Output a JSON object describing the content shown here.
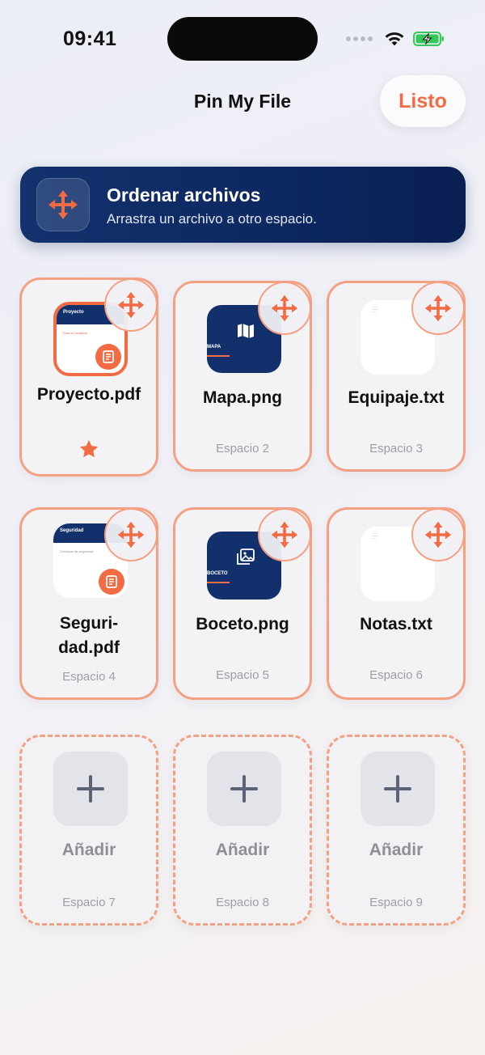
{
  "status_bar": {
    "time": "09:41"
  },
  "header": {
    "title": "Pin My File",
    "done_label": "Listo"
  },
  "banner": {
    "title": "Ordenar archivos",
    "subtitle": "Arrastra un archivo a otro espacio."
  },
  "colors": {
    "accent": "#f26b43",
    "navy": "#12306b",
    "slot_border": "#f4a083"
  },
  "slots": [
    {
      "file": "Proyecto.pdf",
      "label": "",
      "type": "pdf",
      "thumb_title": "Proyecto",
      "thumb_line": "Plan de proyecto",
      "favorite": true,
      "icon": "move-icon"
    },
    {
      "file": "Mapa.png",
      "label": "Espacio 2",
      "type": "image",
      "thumb_title": "MAPA",
      "icon": "move-icon"
    },
    {
      "file": "Equipaje.txt",
      "label": "Espacio 3",
      "type": "text",
      "icon": "move-icon"
    },
    {
      "file_line1": "Seguri-",
      "file_line2": "dad.pdf",
      "label": "Espacio 4",
      "type": "pdf",
      "thumb_title": "Seguridad",
      "thumb_line": "Consejos de seguridad",
      "icon": "move-icon"
    },
    {
      "file": "Boceto.png",
      "label": "Espacio 5",
      "type": "image",
      "thumb_title": "BOCETO",
      "icon": "move-icon"
    },
    {
      "file": "Notas.txt",
      "label": "Espacio 6",
      "type": "text",
      "icon": "move-icon"
    },
    {
      "add_label": "Añadir",
      "label": "Espacio 7",
      "icon": "plus-icon"
    },
    {
      "add_label": "Añadir",
      "label": "Espacio 8",
      "icon": "plus-icon"
    },
    {
      "add_label": "Añadir",
      "label": "Espacio 9",
      "icon": "plus-icon"
    }
  ]
}
